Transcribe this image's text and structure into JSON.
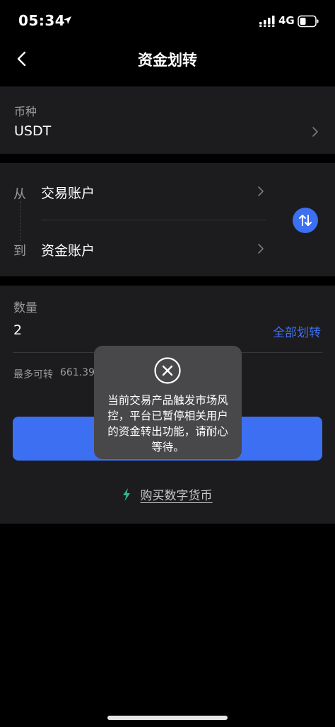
{
  "status_bar": {
    "time": "05:34",
    "network": "4G"
  },
  "nav": {
    "title": "资金划转"
  },
  "currency": {
    "label": "币种",
    "value": "USDT"
  },
  "accounts": {
    "from_label": "从",
    "from_value": "交易账户",
    "to_label": "到",
    "to_value": "资金账户"
  },
  "amount": {
    "label": "数量",
    "value": "2",
    "transfer_all_label": "全部划转",
    "max_label": "最多可转",
    "max_value": "661.392"
  },
  "buy_link": {
    "label": "购买数字货币"
  },
  "toast": {
    "message": "当前交易产品触发市场风控，平台已暂停相关用户的资金转出功能，请耐心等待。"
  },
  "colors": {
    "accent": "#3d6ff2",
    "card": "#1c1c1e",
    "toast": "#48484a",
    "bolt": "#2fb98a"
  }
}
